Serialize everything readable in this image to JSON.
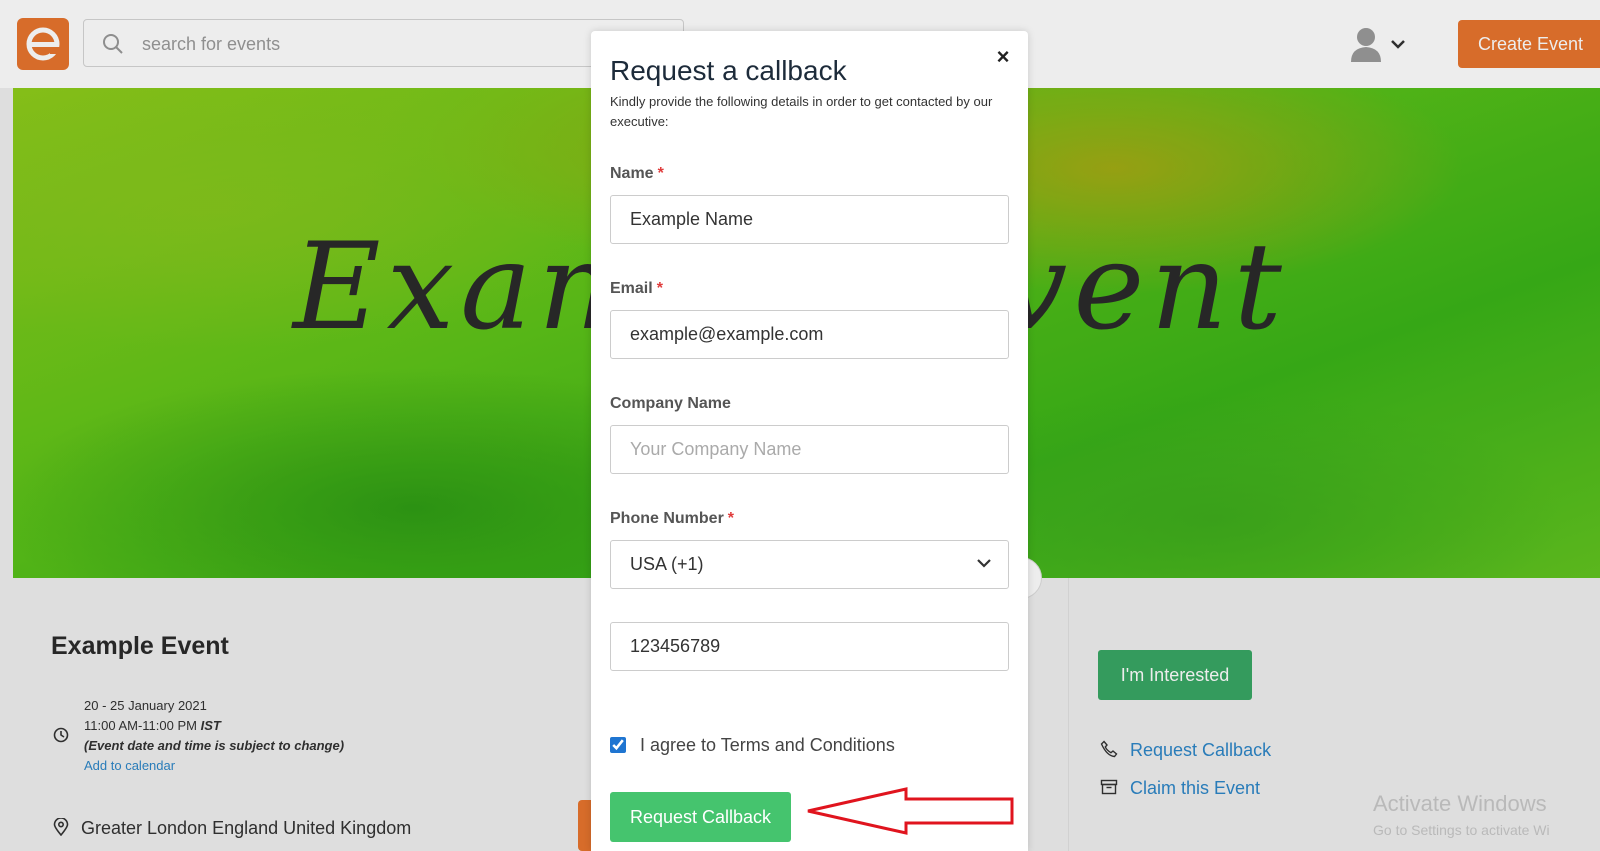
{
  "header": {
    "search_placeholder": "search for events",
    "create_event_label": "Create Event"
  },
  "banner": {
    "title": "Example Event"
  },
  "event": {
    "title": "Example Event",
    "date_range": "20 - 25 January 2021",
    "time": "11:00 AM-11:00 PM",
    "timezone": "IST",
    "date_note": "(Event date and time is subject to change)",
    "add_to_calendar": "Add to calendar",
    "location": "Greater London England United Kingdom"
  },
  "sidebar": {
    "interested_label": "I'm Interested",
    "request_callback_label": "Request Callback",
    "claim_event_label": "Claim this Event"
  },
  "watermark": {
    "line1": "Activate Windows",
    "line2": "Go to Settings to activate Wi"
  },
  "modal": {
    "close": "×",
    "title": "Request a callback",
    "subtitle": "Kindly provide the following details in order to get contacted by our executive:",
    "required_mark": "*",
    "name_label": "Name",
    "name_value": "Example Name",
    "email_label": "Email",
    "email_value": "example@example.com",
    "company_label": "Company Name",
    "company_placeholder": "Your Company Name",
    "phone_label": "Phone Number",
    "country_code": "USA (+1)",
    "phone_value": "123456789",
    "agree_label": "I agree to Terms and Conditions",
    "agree_checked": true,
    "submit_label": "Request Callback"
  },
  "colors": {
    "brand_orange": "#e8752e",
    "green_primary": "#45c46e",
    "green_secondary": "#39a765",
    "link_blue": "#2d86c8",
    "annotation_red": "#e0141e"
  }
}
